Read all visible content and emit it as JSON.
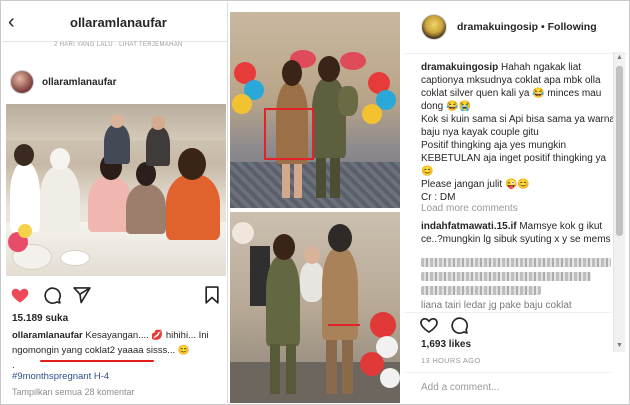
{
  "left_post": {
    "top_username": "ollaramlanaufar",
    "faded_header": "2 HARI YANG LALU · LIHAT TERJEMAHAN",
    "post_username": "ollaramlanaufar",
    "likes": "15.189 suka",
    "caption_user": "ollaramlanaufar",
    "caption_text": " Kesayangan.... 💋 hihihi... Ini ngomongin yang coklat2 yaaaa sisss... 😊",
    "caption_line2": ".",
    "hashtag": "#9monthspregnant H-4",
    "view_all": "Tampilkan semua 28 komentar"
  },
  "right_post": {
    "username": "dramakuingosip",
    "separator": " • ",
    "follow_label": "Following",
    "caption_user": "dramakuingosip",
    "caption_text": " Hahah ngakak liat captionya mksudnya coklat apa mbk olla coklat silver quen kali ya 😂 minces mau dong 😂😭",
    "caption_p2": "Kok si kuin sama si Api bisa sama ya warna baju nya kayak couple gitu",
    "caption_p3": "Positif thingking aja yes mungkin KEBETULAN aja inget positif thingking ya 😊",
    "caption_p4": "Please jangan julit 😜😊",
    "caption_p5": "Cr : DM",
    "load_more": "Load more comments",
    "comment1_user": "indahfatmawati.15.if",
    "comment1_text": " Mamsye kok g ikut ce..?mungkin lg sibuk syuting x y se mems",
    "comment3_user": "liana tairi",
    "comment3_text": " ledar jg pake baju coklat",
    "likes": "1,693 likes",
    "time": "13 HOURS AGO",
    "add_comment": "Add a comment..."
  },
  "colors": {
    "like_red": "#ed4956",
    "annotation_red": "#e41b1b",
    "text": "#262626",
    "muted": "#999999"
  }
}
